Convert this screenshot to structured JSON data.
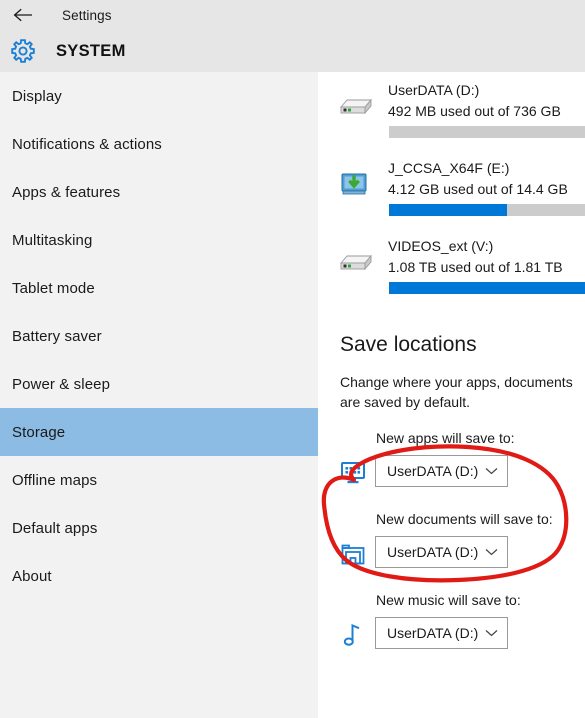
{
  "window": {
    "title": "Settings",
    "back_icon": "back-arrow-icon"
  },
  "header": {
    "title": "SYSTEM",
    "icon": "gear-icon"
  },
  "sidebar": {
    "items": [
      {
        "label": "Display",
        "selected": false
      },
      {
        "label": "Notifications & actions",
        "selected": false
      },
      {
        "label": "Apps & features",
        "selected": false
      },
      {
        "label": "Multitasking",
        "selected": false
      },
      {
        "label": "Tablet mode",
        "selected": false
      },
      {
        "label": "Battery saver",
        "selected": false
      },
      {
        "label": "Power & sleep",
        "selected": false
      },
      {
        "label": "Storage",
        "selected": true
      },
      {
        "label": "Offline maps",
        "selected": false
      },
      {
        "label": "Default apps",
        "selected": false
      },
      {
        "label": "About",
        "selected": false
      }
    ],
    "selected_label": "Storage",
    "highlight_color": "#8cbce4"
  },
  "main": {
    "drives": [
      {
        "name": "UserDATA (D:)",
        "usage": "492 MB used out of 736 GB",
        "used_percent": 0,
        "icon": "external-hard-drive-icon"
      },
      {
        "name": "J_CCSA_X64F (E:)",
        "usage": "4.12 GB used out of 14.4 GB",
        "used_percent": 56,
        "icon": "removable-drive-download-icon"
      },
      {
        "name": "VIDEOS_ext (V:)",
        "usage": "1.08 TB used out of 1.81 TB",
        "used_percent": 100,
        "icon": "external-hard-drive-icon"
      }
    ],
    "save_locations": {
      "heading": "Save locations",
      "description": "Change where your apps, documents are saved by default.",
      "groups": [
        {
          "label": "New apps will save to:",
          "value": "UserDATA (D:)",
          "icon": "monitor-apps-icon"
        },
        {
          "label": "New documents will save to:",
          "value": "UserDATA (D:)",
          "icon": "documents-folder-icon"
        },
        {
          "label": "New music will save to:",
          "value": "UserDATA (D:)",
          "icon": "music-note-icon"
        }
      ]
    }
  },
  "annotation": {
    "shape": "hand-drawn-red-ellipse",
    "color": "#e01b15",
    "targets": "new-apps-save-location"
  },
  "colors": {
    "accent_blue": "#0078d7",
    "chrome_gray": "#e6e6e6",
    "sidebar_gray": "#f2f2f2",
    "bar_track": "#cccccc",
    "annotation_red": "#e01b15"
  }
}
